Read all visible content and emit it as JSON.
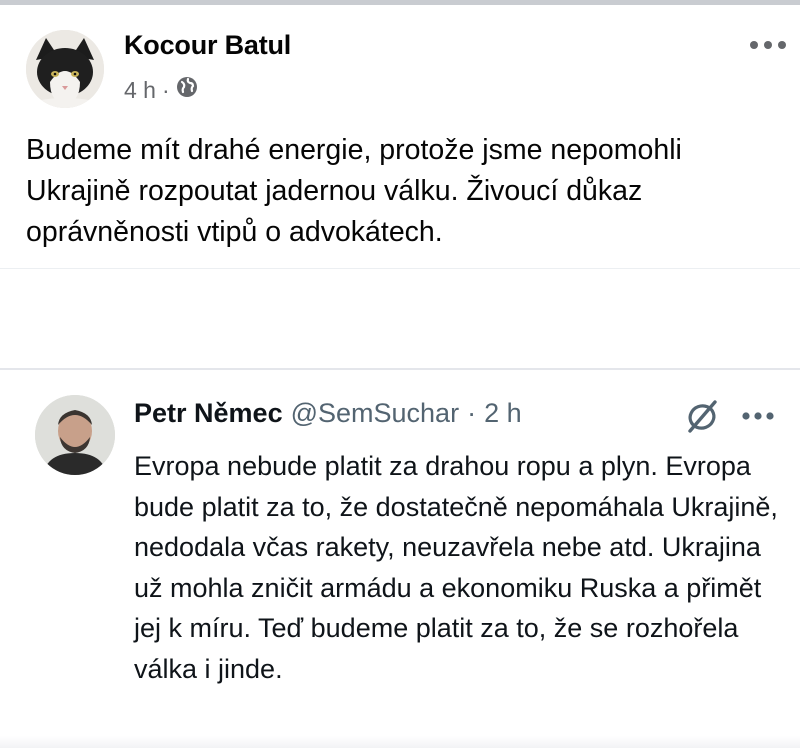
{
  "post": {
    "author": "Kocour Batul",
    "time": "4 h",
    "meta_separator": "·",
    "privacy_icon": "globe-icon",
    "more_icon": "more-dots-icon",
    "text": "Budeme mít drahé energie, protože jsme nepomohli Ukrajině rozpoutat jadernou válku. Živoucí důkaz oprávněnosti vtipů o advokátech."
  },
  "tweet": {
    "name": "Petr Němec",
    "handle": "@SemSuchar",
    "separator": "·",
    "time": "2 h",
    "logo_icon": "x-logo-icon",
    "more_icon": "more-dots-icon",
    "text": "Evropa nebude platit za drahou ropu a plyn. Evropa bude platit za to, že dostatečně nepomáhala Ukrajině, nedodala včas rakety, neuzavřela nebe atd. Ukrajina už mohla zničit armádu a ekonomiku Ruska a přimět jej k míru. Teď budeme platit za to, že se rozhořela válka i jinde."
  },
  "colors": {
    "text_primary": "#050505",
    "text_secondary": "#65676b",
    "tweet_secondary": "#536471",
    "divider": "#e4e6eb"
  }
}
